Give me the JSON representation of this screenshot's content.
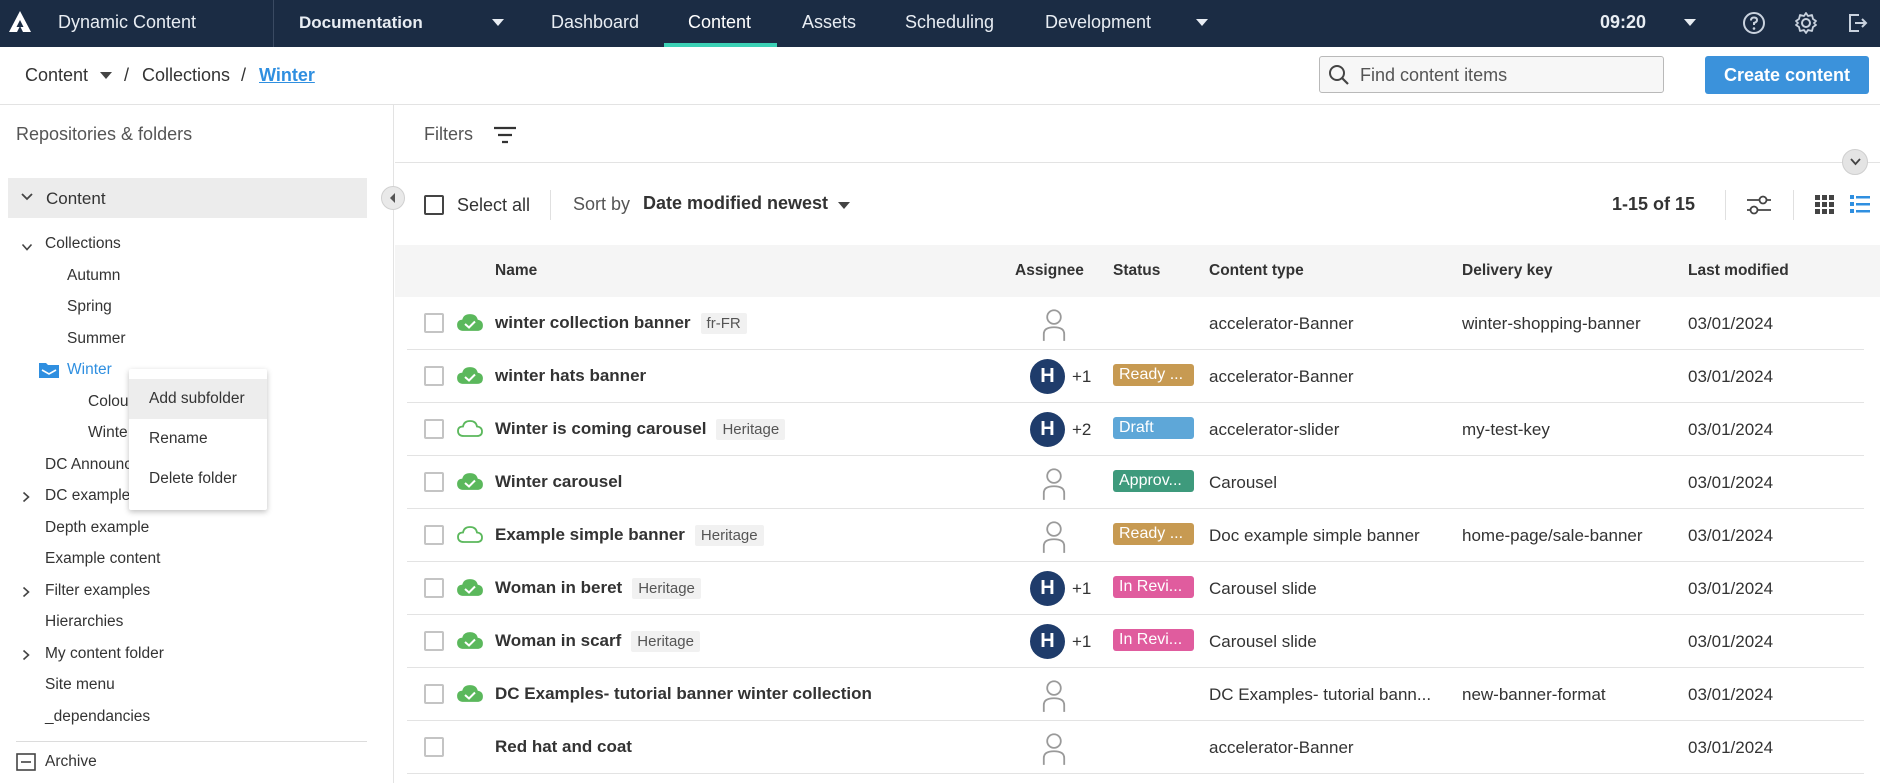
{
  "topbar": {
    "app_title": "Dynamic Content",
    "hub": "Documentation",
    "nav": [
      "Dashboard",
      "Content",
      "Assets",
      "Scheduling",
      "Development"
    ],
    "active_nav": "Content",
    "clock": "09:20"
  },
  "breadcrumb": {
    "root": "Content",
    "sep1": "/",
    "middle": "Collections",
    "sep2": "/",
    "current": "Winter"
  },
  "search": {
    "placeholder": "Find content items"
  },
  "create_button": "Create content",
  "sidebar": {
    "title": "Repositories & folders",
    "root": "Content",
    "collections": "Collections",
    "autumn": "Autumn",
    "spring": "Spring",
    "summer": "Summer",
    "winter": "Winter",
    "winter_child_1": "Colou",
    "winter_child_2": "Winte",
    "dc_announcements": "DC Announc",
    "dc_examples": "DC example",
    "depth_example": "Depth example",
    "example_content": "Example content",
    "filter_examples": "Filter examples",
    "hierarchies": "Hierarchies",
    "my_content_folder": "My content folder",
    "site_menu": "Site menu",
    "dependancies": "_dependancies",
    "archive": "Archive"
  },
  "context_menu": {
    "add_subfolder": "Add subfolder",
    "rename": "Rename",
    "delete_folder": "Delete folder"
  },
  "filters": {
    "label": "Filters"
  },
  "toolbar": {
    "select_all": "Select all",
    "sort_by": "Sort by",
    "sort_value": "Date modified newest",
    "range": "1-15 of 15"
  },
  "columns": {
    "name": "Name",
    "assignee": "Assignee",
    "status": "Status",
    "content_type": "Content type",
    "delivery_key": "Delivery key",
    "last_modified": "Last modified"
  },
  "status_colors": {
    "ready": "#c79a52",
    "draft": "#5ea7d8",
    "approved": "#3e9a7c",
    "review": "#e05c9e"
  },
  "rows": [
    {
      "name": "winter collection banner",
      "tag": "fr-FR",
      "assignee": "",
      "extra": "",
      "status": "",
      "content_type": "accelerator-Banner",
      "delivery_key": "winter-shopping-banner",
      "last_modified": "03/01/2024"
    },
    {
      "name": "winter hats banner",
      "tag": "",
      "assignee": "H",
      "extra": "+1",
      "status": "Ready ...",
      "content_type": "accelerator-Banner",
      "delivery_key": "",
      "last_modified": "03/01/2024"
    },
    {
      "name": "Winter is coming carousel",
      "tag": "Heritage",
      "assignee": "H",
      "extra": "+2",
      "status": "Draft",
      "content_type": "accelerator-slider",
      "delivery_key": "my-test-key",
      "last_modified": "03/01/2024"
    },
    {
      "name": "Winter carousel",
      "tag": "",
      "assignee": "",
      "extra": "",
      "status": "Approv...",
      "content_type": "Carousel",
      "delivery_key": "",
      "last_modified": "03/01/2024"
    },
    {
      "name": "Example simple banner",
      "tag": "Heritage",
      "assignee": "",
      "extra": "",
      "status": "Ready ...",
      "content_type": "Doc example simple banner",
      "delivery_key": "home-page/sale-banner",
      "last_modified": "03/01/2024"
    },
    {
      "name": "Woman in beret",
      "tag": "Heritage",
      "assignee": "H",
      "extra": "+1",
      "status": "In Revi...",
      "content_type": "Carousel slide",
      "delivery_key": "",
      "last_modified": "03/01/2024"
    },
    {
      "name": "Woman in scarf",
      "tag": "Heritage",
      "assignee": "H",
      "extra": "+1",
      "status": "In Revi...",
      "content_type": "Carousel slide",
      "delivery_key": "",
      "last_modified": "03/01/2024"
    },
    {
      "name": "DC Examples- tutorial banner winter collection",
      "tag": "",
      "assignee": "",
      "extra": "",
      "status": "",
      "content_type": "DC Examples- tutorial bann...",
      "delivery_key": "new-banner-format",
      "last_modified": "03/01/2024"
    },
    {
      "name": "Red hat and coat",
      "tag": "",
      "assignee": "",
      "extra": "",
      "status": "",
      "content_type": "accelerator-Banner",
      "delivery_key": "",
      "last_modified": "03/01/2024"
    }
  ]
}
